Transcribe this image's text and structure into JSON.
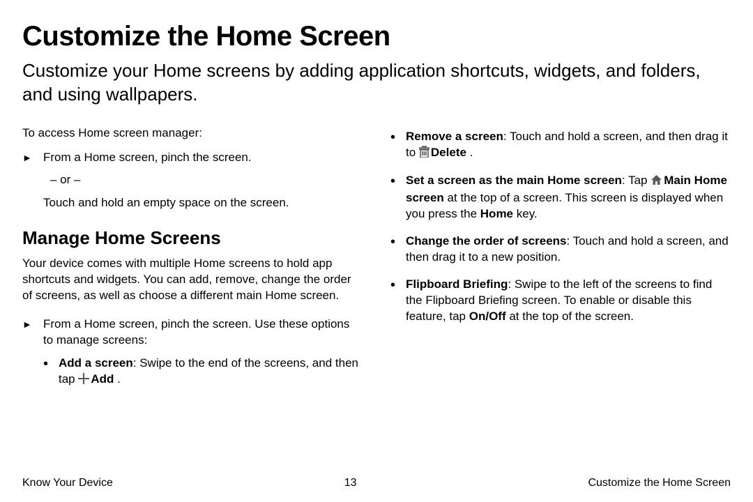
{
  "page": {
    "title": "Customize the Home Screen",
    "intro": "Customize your Home screens by adding application shortcuts, widgets, and folders, and using wallpapers."
  },
  "access": {
    "lead": "To access Home screen manager:",
    "arrow_marker": "►",
    "item1": "From a Home screen, pinch the screen.",
    "or": "– or –",
    "item2": "Touch and hold an empty space on the screen."
  },
  "manage": {
    "heading": "Manage Home Screens",
    "para": "Your device comes with multiple Home screens to hold app shortcuts and widgets. You can add, remove, change the order of screens, as well as choose a different main Home screen.",
    "arrow_marker": "►",
    "arrow_text": "From a Home screen, pinch the screen. Use these options to manage screens:"
  },
  "bullets": {
    "add": {
      "title": "Add a screen",
      "before": ": Swipe to the end of the screens, and then tap ",
      "icon_label": "Add",
      "after": " ."
    },
    "remove": {
      "title": "Remove a screen",
      "before": ": Touch and hold a screen, and then drag it to ",
      "icon_label": "Delete",
      "after": " ."
    },
    "main": {
      "title": "Set a screen as the main Home screen",
      "before": ": Tap ",
      "icon_label": "Main Home screen",
      "mid": " at the top of a screen. This screen is displayed when you press the ",
      "home_key": "Home",
      "after": " key."
    },
    "order": {
      "title": "Change the order of screens",
      "text": ": Touch and hold a screen, and then drag it to a new position."
    },
    "flip": {
      "title": "Flipboard Briefing",
      "before": ": Swipe to the left of the screens to find the Flipboard Briefing screen. To enable or disable this feature, tap ",
      "onoff": "On/Off",
      "after": " at the top of the screen."
    }
  },
  "footer": {
    "left": "Know Your Device",
    "center": "13",
    "right": "Customize the Home Screen"
  }
}
